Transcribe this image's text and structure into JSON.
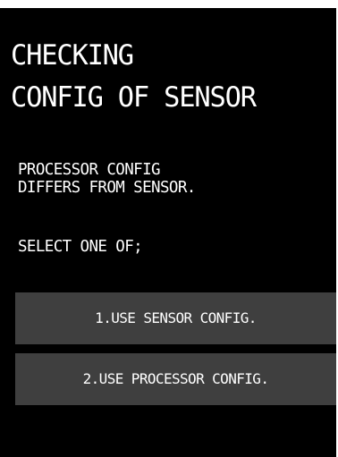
{
  "title": {
    "line1": "CHECKING",
    "line2": "CONFIG OF SENSOR"
  },
  "message": {
    "line1": "PROCESSOR CONFIG",
    "line2": "DIFFERS FROM SENSOR."
  },
  "prompt": "SELECT ONE OF;",
  "options": [
    {
      "label": "1.USE SENSOR CONFIG."
    },
    {
      "label": "2.USE PROCESSOR CONFIG."
    }
  ],
  "colors": {
    "background": "#000000",
    "text": "#ffffff",
    "button": "#3f3f3f"
  }
}
